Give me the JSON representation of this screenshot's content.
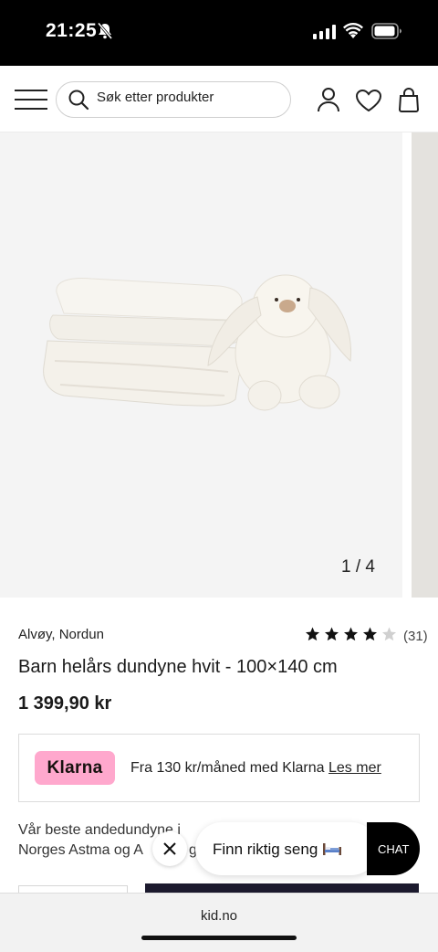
{
  "status": {
    "time": "21:25",
    "icons": [
      "bell-muted-icon",
      "signal-icon",
      "wifi-icon",
      "battery-icon"
    ]
  },
  "header": {
    "search_placeholder": "Søk etter produkter",
    "icons": [
      "menu-icon",
      "search-icon",
      "account-icon",
      "wishlist-heart-icon",
      "cart-bag-icon"
    ]
  },
  "gallery": {
    "counter": "1 / 4",
    "current": 1,
    "total": 4
  },
  "product": {
    "brand": "Alvøy, Nordun",
    "rating_count": "(31)",
    "rating_value": 4,
    "rating_max": 5,
    "title": "Barn helårs dundyne hvit - 100×140 cm",
    "price": "1 399,90 kr"
  },
  "klarna": {
    "badge": "Klarna",
    "text": "Fra 130 kr/måned med Klarna",
    "link": "Les mer"
  },
  "description": {
    "line1": "Vår beste andedundyne i",
    "line2": "Norges Astma og A",
    "line2_tail": "gi"
  },
  "chat": {
    "bubble_text": "Finn riktig seng",
    "chat_label": "CHAT"
  },
  "browser": {
    "url": "kid.no"
  },
  "colors": {
    "klarna_pink": "#ffa8cd",
    "cta_dark": "#1c1a2e",
    "star": "#111111",
    "star_empty": "#d0d0d0"
  }
}
